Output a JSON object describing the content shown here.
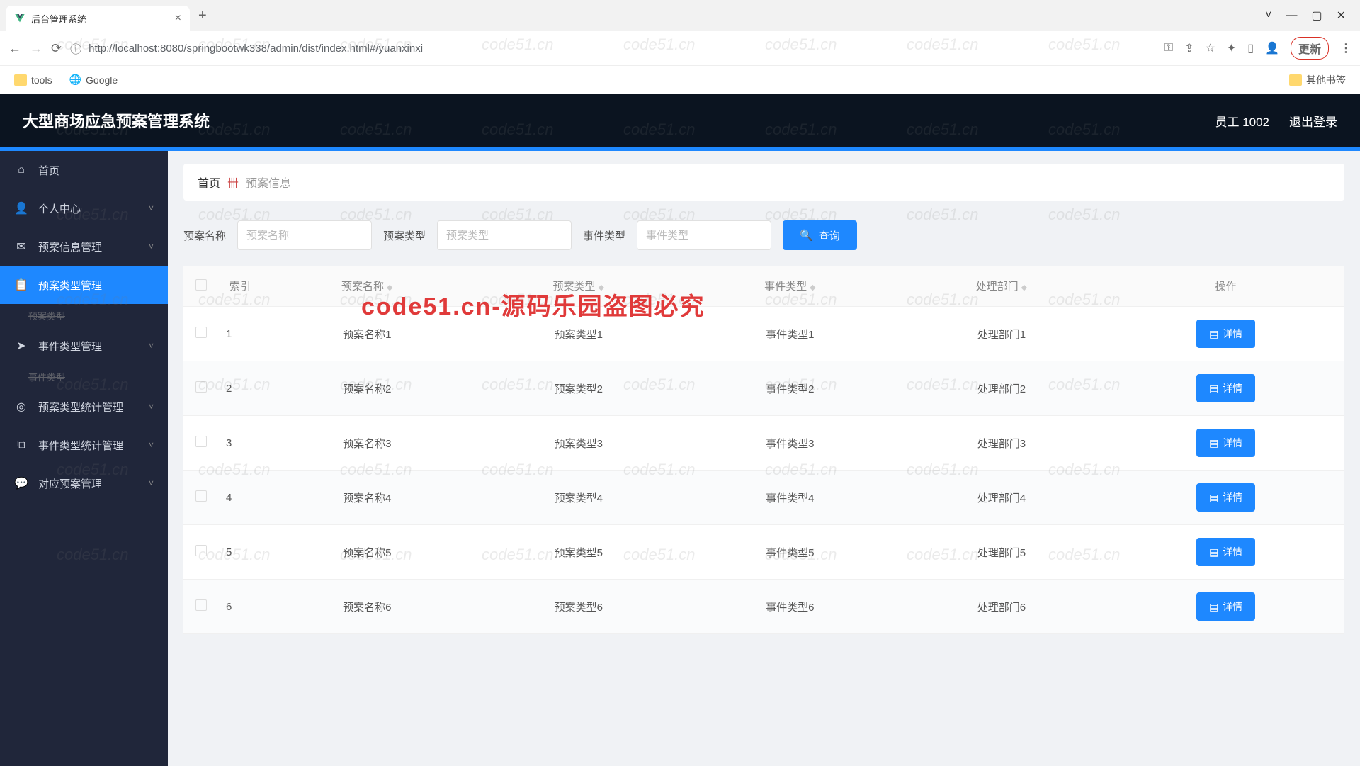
{
  "browser": {
    "tab_title": "后台管理系统",
    "url": "http://localhost:8080/springbootwk338/admin/dist/index.html#/yuanxinxi",
    "update_label": "更新",
    "bookmarks": {
      "tools": "tools",
      "google": "Google",
      "other": "其他书签"
    }
  },
  "header": {
    "app_title": "大型商场应急预案管理系统",
    "user_label": "员工 1002",
    "logout": "退出登录"
  },
  "sidebar": {
    "items": [
      {
        "label": "首页"
      },
      {
        "label": "个人中心"
      },
      {
        "label": "预案信息管理"
      },
      {
        "label": "预案类型管理"
      },
      {
        "label": "事件类型管理"
      },
      {
        "label": "预案类型统计管理"
      },
      {
        "label": "事件类型统计管理"
      },
      {
        "label": "对应预案管理"
      }
    ],
    "sub1": "预案类型",
    "sub2": "事件类型"
  },
  "breadcrumb": {
    "home": "首页",
    "current": "预案信息"
  },
  "search": {
    "f1_label": "预案名称",
    "f1_ph": "预案名称",
    "f2_label": "预案类型",
    "f2_ph": "预案类型",
    "f3_label": "事件类型",
    "f3_ph": "事件类型",
    "query": "查询"
  },
  "table": {
    "headers": {
      "index": "索引",
      "c1": "预案名称",
      "c2": "预案类型",
      "c3": "事件类型",
      "c4": "处理部门",
      "ops": "操作"
    },
    "detail_label": "详情",
    "rows": [
      {
        "idx": "1",
        "c1": "预案名称1",
        "c2": "预案类型1",
        "c3": "事件类型1",
        "c4": "处理部门1"
      },
      {
        "idx": "2",
        "c1": "预案名称2",
        "c2": "预案类型2",
        "c3": "事件类型2",
        "c4": "处理部门2"
      },
      {
        "idx": "3",
        "c1": "预案名称3",
        "c2": "预案类型3",
        "c3": "事件类型3",
        "c4": "处理部门3"
      },
      {
        "idx": "4",
        "c1": "预案名称4",
        "c2": "预案类型4",
        "c3": "事件类型4",
        "c4": "处理部门4"
      },
      {
        "idx": "5",
        "c1": "预案名称5",
        "c2": "预案类型5",
        "c3": "事件类型5",
        "c4": "处理部门5"
      },
      {
        "idx": "6",
        "c1": "预案名称6",
        "c2": "预案类型6",
        "c3": "事件类型6",
        "c4": "处理部门6"
      }
    ]
  },
  "watermarks": {
    "wm": "code51.cn",
    "center": "code51.cn-源码乐园盗图必究"
  }
}
